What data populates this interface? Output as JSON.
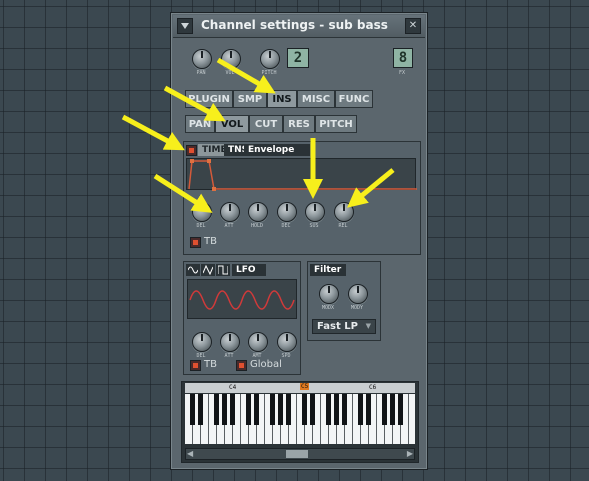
{
  "window": {
    "title": "Channel settings - sub bass",
    "menu_icon": "triangle-down-icon",
    "close_label": "✕"
  },
  "top": {
    "knobs": [
      {
        "name": "pan-knob",
        "label": "PAN"
      },
      {
        "name": "vol-knob",
        "label": "VOL"
      },
      {
        "name": "pitch-knob",
        "label": "PITCH"
      }
    ],
    "channel_lcd": "2",
    "fx_lcd": "8",
    "fx_label": "FX"
  },
  "main_tabs": [
    {
      "label": "PLUGIN",
      "active": false
    },
    {
      "label": "SMP",
      "active": false
    },
    {
      "label": "INS",
      "active": true
    },
    {
      "label": "MISC",
      "active": false
    },
    {
      "label": "FUNC",
      "active": false
    }
  ],
  "sub_tabs": [
    {
      "label": "PAN",
      "active": false
    },
    {
      "label": "VOL",
      "active": true
    },
    {
      "label": "CUT",
      "active": false
    },
    {
      "label": "RES",
      "active": false
    },
    {
      "label": "PITCH",
      "active": false
    }
  ],
  "envelope": {
    "time_label": "TIME",
    "tns_label": "TNS",
    "title": "Envelope",
    "knobs": [
      "DEL",
      "ATT",
      "HOLD",
      "DEC",
      "SUS",
      "REL"
    ],
    "tb_label": "TB"
  },
  "lfo": {
    "title": "LFO",
    "knobs": [
      "DEL",
      "ATT",
      "AMT",
      "SPD"
    ],
    "tb_label": "TB",
    "global_label": "Global"
  },
  "filter": {
    "title": "Filter",
    "knobs": [
      "MODX",
      "MODY"
    ],
    "type_value": "Fast LP"
  },
  "keyboard": {
    "labels": [
      "C4",
      "C5",
      "C6"
    ]
  },
  "colors": {
    "arrow": "#f7ef1c",
    "window_bg": "#5b666d",
    "lcd_bg": "#8fb4a4",
    "lfo_wave": "#d03a3a"
  }
}
